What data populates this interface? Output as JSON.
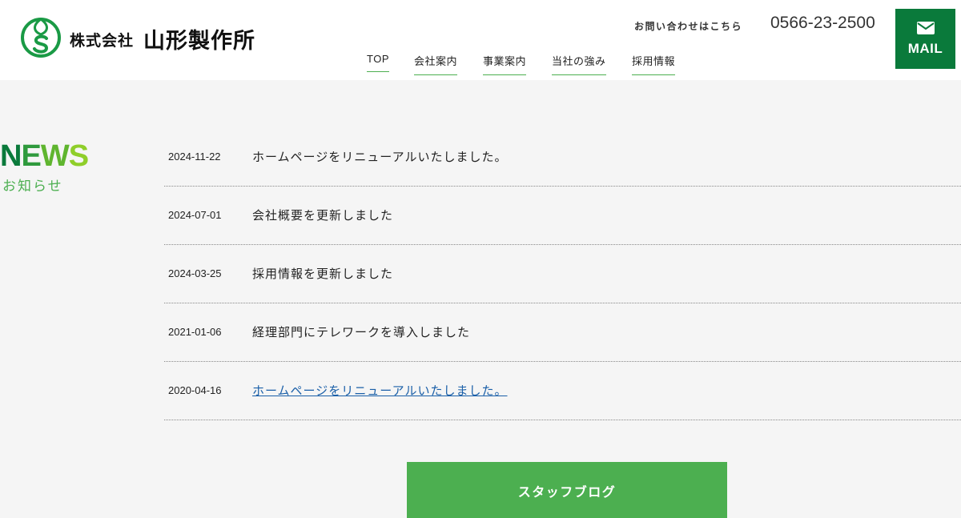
{
  "header": {
    "logo_small": "株式会社",
    "logo_company": "山形製作所",
    "logo_icon": "company-logo-icon",
    "contact_label": "お問い合わせはこちら",
    "phone": "0566-23-2500",
    "mail_label": "MAIL",
    "mail_icon": "mail-icon"
  },
  "nav": {
    "items": [
      {
        "label": "TOP"
      },
      {
        "label": "会社案内"
      },
      {
        "label": "事業案内"
      },
      {
        "label": "当社の強み"
      },
      {
        "label": "採用情報"
      }
    ]
  },
  "news": {
    "title": "NEWS",
    "subtitle": "お知らせ",
    "items": [
      {
        "date": "2024-11-22",
        "text": "ホームページをリニューアルいたしました。"
      },
      {
        "date": "2024-07-01",
        "text": "会社概要を更新しました"
      },
      {
        "date": "2024-03-25",
        "text": "採用情報を更新しました"
      },
      {
        "date": "2021-01-06",
        "text": "経理部門にテレワークを導入しました"
      },
      {
        "date": "2020-04-16",
        "text": "ホームページをリニューアルいたしました。"
      }
    ]
  },
  "blog_button": {
    "label": "スタッフブログ"
  },
  "colors": {
    "brand_green": "#0a7a3b",
    "accent_green": "#4caf50",
    "link_blue": "#1a5fa8"
  }
}
